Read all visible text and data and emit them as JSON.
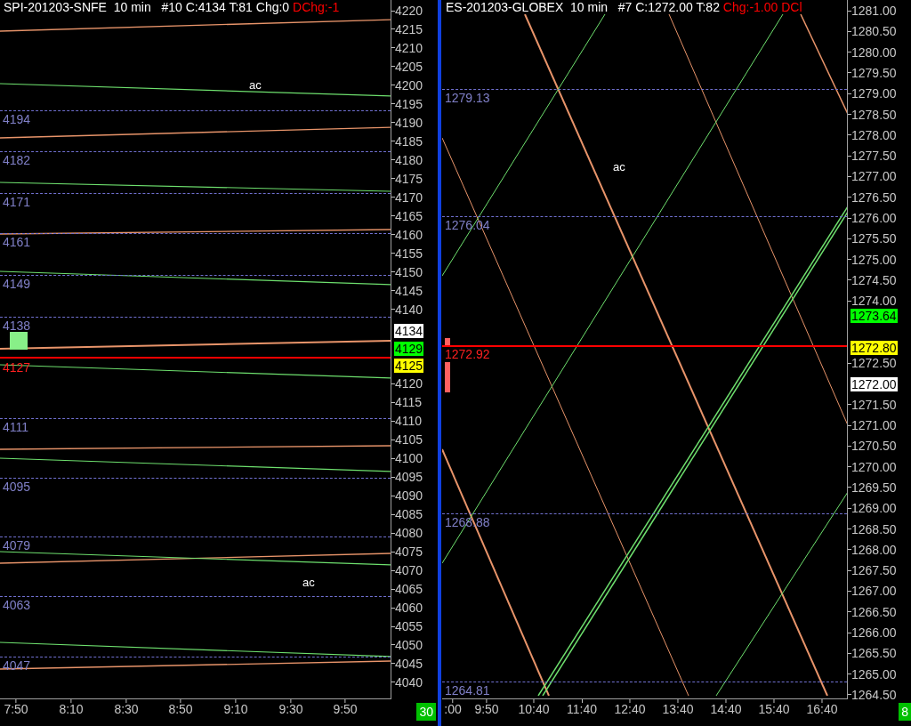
{
  "panels": [
    {
      "header": {
        "text": "SPI-201203-SNFE  10 min   #10 C:4134 T:81 Chg:0 ",
        "alert": "DChg:-1"
      },
      "annotations": [
        "ac",
        "ac"
      ],
      "levels": [
        "4194",
        "4182",
        "4171",
        "4161",
        "4149",
        "4138",
        "4111",
        "4095",
        "4079",
        "4063",
        "4047"
      ],
      "current_price": "4127",
      "y_ticks": [
        "4220",
        "4215",
        "4210",
        "4205",
        "4200",
        "4195",
        "4190",
        "4185",
        "4180",
        "4175",
        "4170",
        "4165",
        "4160",
        "4155",
        "4150",
        "4145",
        "4140",
        "4120",
        "4115",
        "4110",
        "4105",
        "4100",
        "4095",
        "4090",
        "4085",
        "4080",
        "4075",
        "4070",
        "4065",
        "4060",
        "4055",
        "4050",
        "4045",
        "4040"
      ],
      "price_tags": [
        {
          "label": "4134",
          "color": "#ffffff"
        },
        {
          "label": "4129",
          "color": "#00ff00"
        },
        {
          "label": "4125",
          "color": "#ffff00"
        }
      ],
      "x_ticks": [
        "7:50",
        "8:10",
        "8:30",
        "8:50",
        "9:10",
        "9:30",
        "9:50"
      ],
      "bar_count": "30"
    },
    {
      "header": {
        "text": "ES-201203-GLOBEX  10 min   #7 C:1272.00 T:82 ",
        "alert": "Chg:-1.00 DCl"
      },
      "annotations": [
        "ac"
      ],
      "levels": [
        "1279.13",
        "1276.04",
        "1268.88",
        "1264.81"
      ],
      "current_price": "1272.92",
      "y_ticks": [
        "1281.00",
        "1280.50",
        "1280.00",
        "1279.50",
        "1279.00",
        "1278.50",
        "1278.00",
        "1277.50",
        "1277.00",
        "1276.50",
        "1276.00",
        "1275.50",
        "1275.00",
        "1274.50",
        "1274.00",
        "1272.50",
        "1271.50",
        "1271.00",
        "1270.50",
        "1270.00",
        "1269.50",
        "1269.00",
        "1268.50",
        "1268.00",
        "1267.50",
        "1267.00",
        "1266.50",
        "1266.00",
        "1265.50",
        "1265.00",
        "1264.50"
      ],
      "price_tags": [
        {
          "label": "1273.64",
          "color": "#00ff00"
        },
        {
          "label": "1272.80",
          "color": "#ffff00"
        },
        {
          "label": "1272.00",
          "color": "#ffffff"
        }
      ],
      "x_ticks": [
        ":00",
        "9:50",
        "10:40",
        "11:40",
        "12:40",
        "13:40",
        "14:40",
        "15:40",
        "16:40"
      ],
      "bar_count": "8"
    }
  ]
}
